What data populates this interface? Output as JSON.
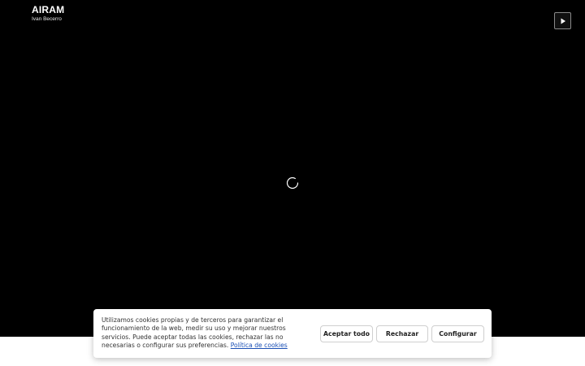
{
  "header": {
    "title": "AIRAM",
    "subtitle": "Ivan Becerro"
  },
  "controls": {
    "play_icon": "play-icon",
    "loading_icon": "loading-spinner-icon"
  },
  "cookie_banner": {
    "text": "Utilizamos cookies propias y de terceros para garantizar el funcionamiento de la web, medir su uso y mejorar nuestros servicios. Puede aceptar todas las cookies, rechazar las no necesarias o configurar sus preferencias.",
    "link_label": "Política de cookies",
    "accept_label": "Aceptar todo",
    "reject_label": "Rechazar",
    "configure_label": "Configurar"
  },
  "colors": {
    "background": "#000000",
    "link": "#1a4fb5",
    "banner": "#ffffff"
  }
}
